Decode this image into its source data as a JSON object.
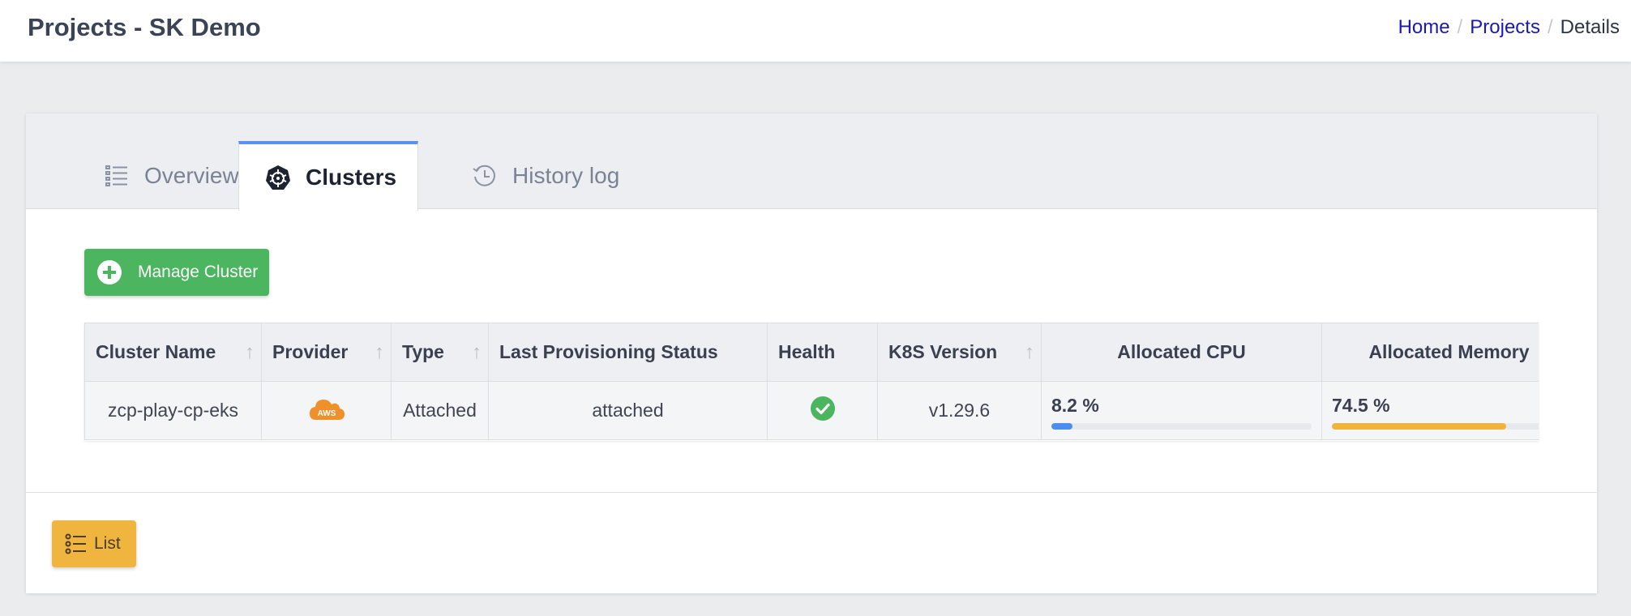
{
  "header": {
    "title": "Projects - SK Demo",
    "breadcrumb": {
      "home": "Home",
      "projects": "Projects",
      "current": "Details",
      "separator": "/"
    }
  },
  "tabs": {
    "overview": "Overview",
    "clusters": "Clusters",
    "history": "History log",
    "active": "Clusters"
  },
  "actions": {
    "manage_cluster": "Manage Cluster",
    "list": "List"
  },
  "table": {
    "headers": {
      "cluster_name": "Cluster Name",
      "provider": "Provider",
      "type": "Type",
      "last_status": "Last Provisioning Status",
      "health": "Health",
      "k8s_version": "K8S Version",
      "allocated_cpu": "Allocated CPU",
      "allocated_memory": "Allocated Memory"
    },
    "sort_arrow": "↑",
    "rows": [
      {
        "cluster_name": "zcp-play-cp-eks",
        "provider_icon": "aws-cloud-icon",
        "provider_label": "AWS",
        "type": "Attached",
        "last_status": "attached",
        "health_icon": "check-circle-icon",
        "k8s_version": "v1.29.6",
        "cpu_text": "8.2 %",
        "cpu_value": 8.2,
        "memory_text": "74.5 %",
        "memory_value": 74.5
      }
    ]
  },
  "colors": {
    "accent_tab": "#5b8ff0",
    "primary_green": "#4cb560",
    "list_button": "#efb53f",
    "cpu_bar": "#4a8ef0",
    "memory_bar": "#f0b43c",
    "link": "#1b18b8",
    "aws_orange": "#f0902a"
  }
}
